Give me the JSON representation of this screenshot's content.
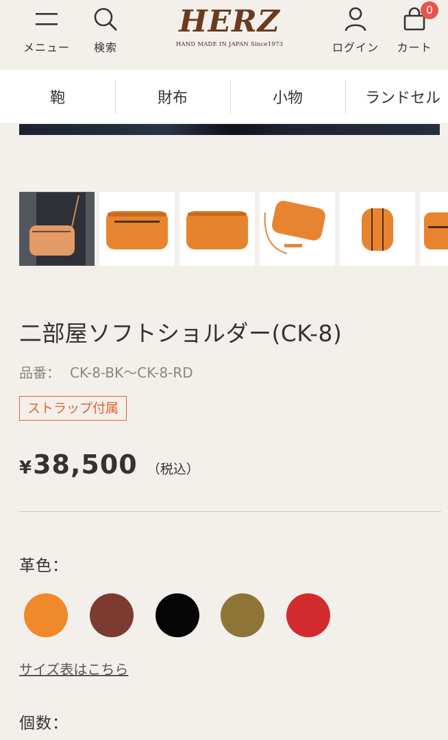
{
  "header": {
    "menu_label": "メニュー",
    "search_label": "検索",
    "login_label": "ログイン",
    "cart_label": "カート",
    "cart_count": "0",
    "logo_text": "HERZ",
    "logo_tagline": "HAND MADE IN JAPAN Since1973"
  },
  "categories": [
    "鞄",
    "財布",
    "小物",
    "ランドセル"
  ],
  "thumbnails": [
    {
      "icon": "model-wearing-bag-photo"
    },
    {
      "icon": "bag-front-photo"
    },
    {
      "icon": "bag-back-photo"
    },
    {
      "icon": "bag-with-strap-photo"
    },
    {
      "icon": "bag-side-photo"
    },
    {
      "icon": "bag-detail-photo"
    }
  ],
  "product": {
    "title": "二部屋ソフトショルダー(CK-8)",
    "sku_label": "品番：",
    "sku_value": "CK-8-BK〜CK-8-RD",
    "badge": "ストラップ付属",
    "price_symbol": "¥",
    "price": "38,500",
    "tax_note": "（税込）"
  },
  "options": {
    "color_label": "革色：",
    "colors": [
      "#f0892b",
      "#7d3a30",
      "#050505",
      "#8f7438",
      "#d22b2e"
    ],
    "size_link": "サイズ表はこちら",
    "quantity_label": "個数："
  },
  "theme": {
    "accent": "#e0662a",
    "badge_red": "#e8544b",
    "logo_brown": "#6b3a1f"
  }
}
